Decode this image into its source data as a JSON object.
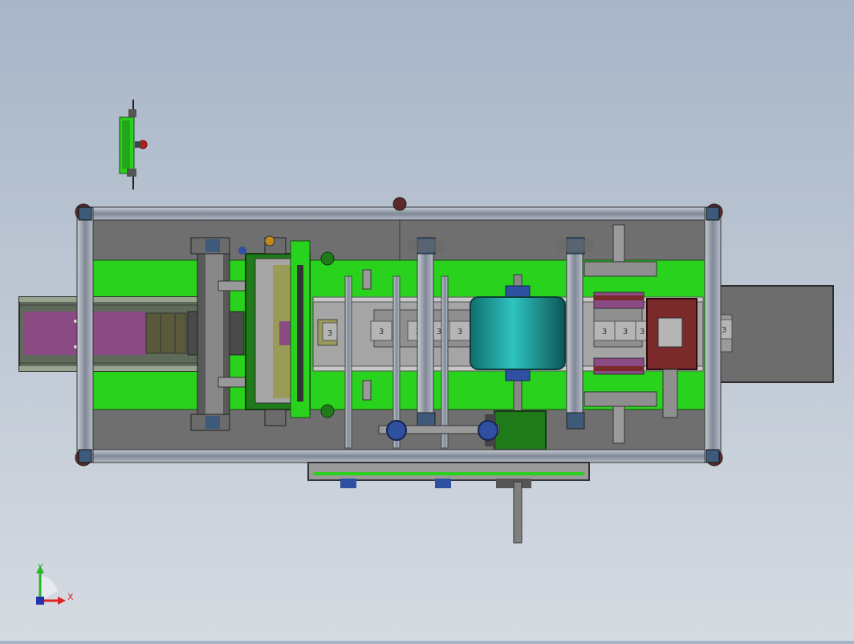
{
  "viewport": {
    "background_top": "#a8b5c7",
    "background_bottom": "#d6dbe2"
  },
  "colors": {
    "frame": "#8a93a3",
    "frame_dark": "#3a3f4a",
    "plate_grey": "#707070",
    "green": "#29d21c",
    "dark_green": "#1f7a1a",
    "purple": "#8a4a84",
    "teal": "#1a9d9b",
    "steel": "#a8a8a8",
    "dark_red": "#7a2a2a",
    "blue_bearing": "#2f4fa0",
    "slate_block": "#3e5a7a"
  },
  "parts": {
    "part_label": "3"
  },
  "triad": {
    "x_label": "X",
    "y_label": "Y",
    "icon": "coordinate-triad-icon"
  }
}
